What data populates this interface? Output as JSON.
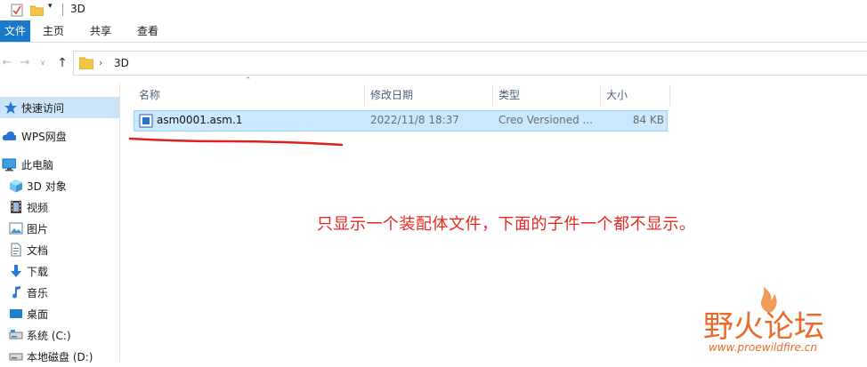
{
  "window": {
    "title": "3D"
  },
  "ribbon": {
    "tabs": [
      {
        "label": "文件"
      },
      {
        "label": "主页"
      },
      {
        "label": "共享"
      },
      {
        "label": "查看"
      }
    ]
  },
  "address": {
    "crumbs": [
      "3D"
    ]
  },
  "nav": {
    "items": [
      {
        "label": "快速访问",
        "icon": "star-icon"
      },
      {
        "label": "WPS网盘",
        "icon": "cloud-icon"
      },
      {
        "label": "此电脑",
        "icon": "computer-icon"
      },
      {
        "label": "3D 对象",
        "icon": "cube-icon"
      },
      {
        "label": "视频",
        "icon": "film-icon"
      },
      {
        "label": "图片",
        "icon": "picture-icon"
      },
      {
        "label": "文档",
        "icon": "document-icon"
      },
      {
        "label": "下载",
        "icon": "download-arrow-icon"
      },
      {
        "label": "音乐",
        "icon": "music-note-icon"
      },
      {
        "label": "桌面",
        "icon": "desktop-icon"
      },
      {
        "label": "系统 (C:)",
        "icon": "drive-icon"
      },
      {
        "label": "本地磁盘 (D:)",
        "icon": "drive-icon"
      }
    ]
  },
  "columns": {
    "name": "名称",
    "date": "修改日期",
    "type": "类型",
    "size": "大小"
  },
  "files": [
    {
      "name": "asm0001.asm.1",
      "date": "2022/11/8 18:37",
      "type": "Creo Versioned ...",
      "size": "84 KB"
    }
  ],
  "annotation": {
    "text": "只显示一个装配体文件，下面的子件一个都不显示。",
    "color": "#e8281f"
  },
  "watermark": {
    "brand": "野火论坛",
    "url": "www.proewildfire.cn"
  },
  "colors": {
    "accent": "#1979ca",
    "selection": "#cce8ff",
    "selection_border": "#99d1ff"
  }
}
